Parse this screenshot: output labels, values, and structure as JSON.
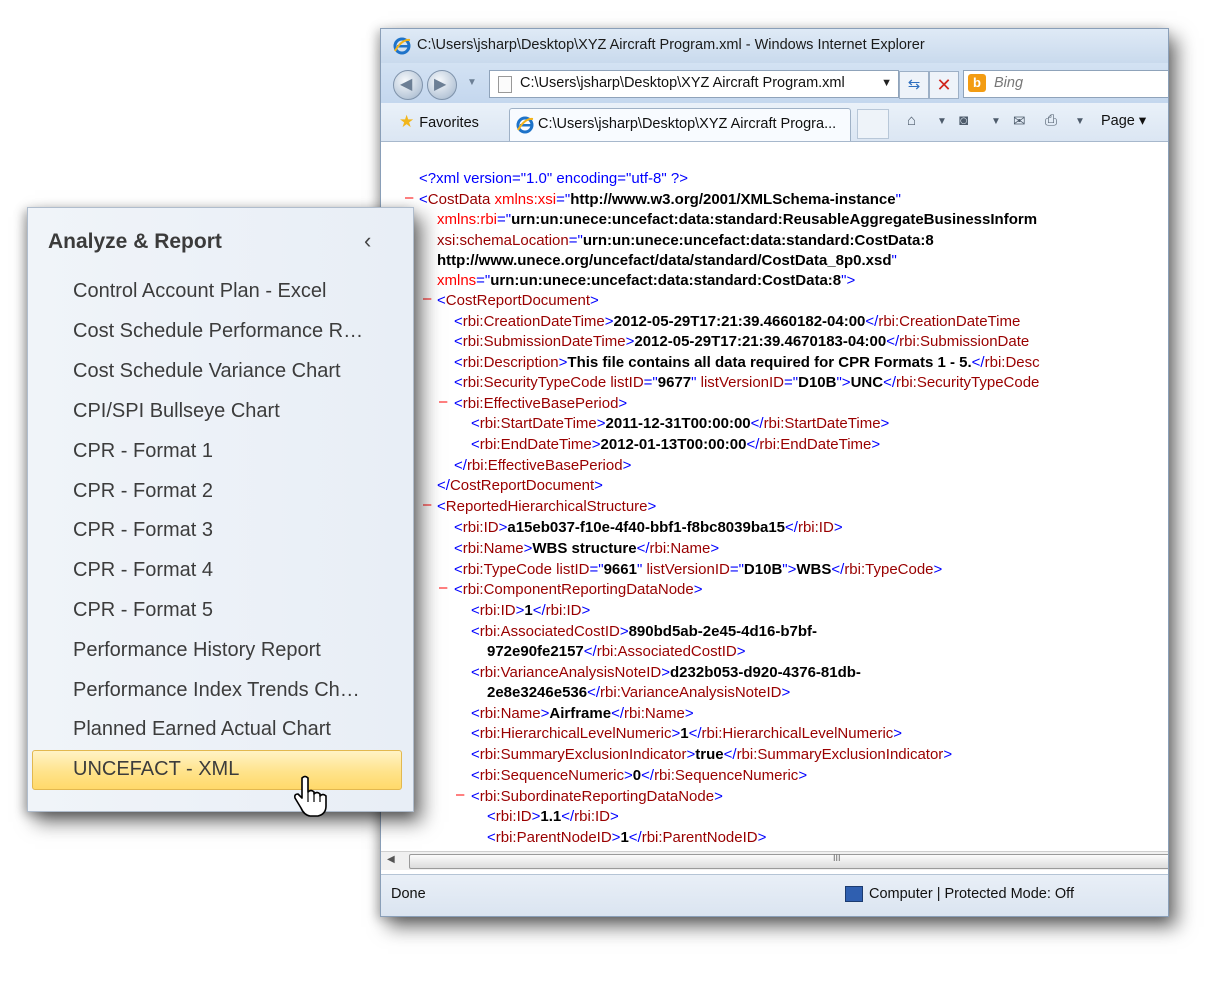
{
  "browser": {
    "title": "C:\\Users\\jsharp\\Desktop\\XYZ Aircraft Program.xml - Windows Internet Explorer",
    "address": "C:\\Users\\jsharp\\Desktop\\XYZ Aircraft Program.xml",
    "search_placeholder": "Bing",
    "favorites_label": "Favorites",
    "tab_label": "C:\\Users\\jsharp\\Desktop\\XYZ Aircraft Progra...",
    "page_label": "Page ▾",
    "status_left": "Done",
    "status_zone": "Computer | Protected Mode: Off",
    "scroll_grip": "III"
  },
  "xml": {
    "l1a": "<?xml version=\"1.0\" encoding=\"utf-8\" ?>",
    "l2a": "<",
    "l2b": "CostData",
    "l2c": " xmlns:xsi",
    "l2d": "=\"",
    "l2e": "http://www.w3.org/2001/XMLSchema-instance",
    "l2f": "\"",
    "l3a": "xmlns:rbi",
    "l3b": "=\"",
    "l3c": "urn:un:unece:uncefact:data:standard:ReusableAggregateBusinessInform",
    "l4a": "xsi:schemaLocation",
    "l4b": "=\"",
    "l4c": "urn:un:unece:uncefact:data:standard:CostData:8",
    "l5a": "http://www.unece.org/uncefact/data/standard/CostData_8p0.xsd",
    "l5b": "\"",
    "l6a": "xmlns",
    "l6b": "=\"",
    "l6c": "urn:un:unece:uncefact:data:standard:CostData:8",
    "l6d": "\">",
    "l7a": "<",
    "l7b": "CostReportDocument",
    "l7c": ">",
    "l8a": "<",
    "l8b": "rbi:CreationDateTime",
    "l8c": ">",
    "l8d": "2012-05-29T17:21:39.4660182-04:00",
    "l8e": "</",
    "l8f": "rbi:CreationDateTime",
    "l9a": "<",
    "l9b": "rbi:SubmissionDateTime",
    "l9c": ">",
    "l9d": "2012-05-29T17:21:39.4670183-04:00",
    "l9e": "</",
    "l9f": "rbi:SubmissionDate",
    "l10a": "<",
    "l10b": "rbi:Description",
    "l10c": ">",
    "l10d": "This file contains all data required for CPR Formats 1 - 5.",
    "l10e": "</",
    "l10f": "rbi:Desc",
    "l11a": "<",
    "l11b": "rbi:SecurityTypeCode",
    "l11c": " listID",
    "l11d": "=\"",
    "l11e": "9677",
    "l11f": "\"",
    "l11g": " listVersionID",
    "l11h": "=\"",
    "l11i": "D10B",
    "l11j": "\">",
    "l11k": "UNC",
    "l11l": "</",
    "l11m": "rbi:SecurityTypeCode",
    "l12a": "<",
    "l12b": "rbi:EffectiveBasePeriod",
    "l12c": ">",
    "l13a": "<",
    "l13b": "rbi:StartDateTime",
    "l13c": ">",
    "l13d": "2011-12-31T00:00:00",
    "l13e": "</",
    "l13f": "rbi:StartDateTime",
    "l13g": ">",
    "l14a": "<",
    "l14b": "rbi:EndDateTime",
    "l14c": ">",
    "l14d": "2012-01-13T00:00:00",
    "l14e": "</",
    "l14f": "rbi:EndDateTime",
    "l14g": ">",
    "l15a": "</",
    "l15b": "rbi:EffectiveBasePeriod",
    "l15c": ">",
    "l16a": "</",
    "l16b": "CostReportDocument",
    "l16c": ">",
    "l17a": "<",
    "l17b": "ReportedHierarchicalStructure",
    "l17c": ">",
    "l18a": "<",
    "l18b": "rbi:ID",
    "l18c": ">",
    "l18d": "a15eb037-f10e-4f40-bbf1-f8bc8039ba15",
    "l18e": "</",
    "l18f": "rbi:ID",
    "l18g": ">",
    "l19a": "<",
    "l19b": "rbi:Name",
    "l19c": ">",
    "l19d": "WBS structure",
    "l19e": "</",
    "l19f": "rbi:Name",
    "l19g": ">",
    "l20a": "<",
    "l20b": "rbi:TypeCode",
    "l20c": " listID",
    "l20d": "=\"",
    "l20e": "9661",
    "l20f": "\"",
    "l20g": " listVersionID",
    "l20h": "=\"",
    "l20i": "D10B",
    "l20j": "\">",
    "l20k": "WBS",
    "l20l": "</",
    "l20m": "rbi:TypeCode",
    "l20n": ">",
    "l21a": "<",
    "l21b": "rbi:ComponentReportingDataNode",
    "l21c": ">",
    "l22a": "<",
    "l22b": "rbi:ID",
    "l22c": ">",
    "l22d": "1",
    "l22e": "</",
    "l22f": "rbi:ID",
    "l22g": ">",
    "l23a": "<",
    "l23b": "rbi:AssociatedCostID",
    "l23c": ">",
    "l23d": "890bd5ab-2e45-4d16-b7bf-",
    "l24a": "972e90fe2157",
    "l24b": "</",
    "l24c": "rbi:AssociatedCostID",
    "l24d": ">",
    "l25a": "<",
    "l25b": "rbi:VarianceAnalysisNoteID",
    "l25c": ">",
    "l25d": "d232b053-d920-4376-81db-",
    "l26a": "2e8e3246e536",
    "l26b": "</",
    "l26c": "rbi:VarianceAnalysisNoteID",
    "l26d": ">",
    "l27a": "<",
    "l27b": "rbi:Name",
    "l27c": ">",
    "l27d": "Airframe",
    "l27e": "</",
    "l27f": "rbi:Name",
    "l27g": ">",
    "l28a": "<",
    "l28b": "rbi:HierarchicalLevelNumeric",
    "l28c": ">",
    "l28d": "1",
    "l28e": "</",
    "l28f": "rbi:HierarchicalLevelNumeric",
    "l28g": ">",
    "l29a": "<",
    "l29b": "rbi:SummaryExclusionIndicator",
    "l29c": ">",
    "l29d": "true",
    "l29e": "</",
    "l29f": "rbi:SummaryExclusionIndicator",
    "l29g": ">",
    "l30a": "<",
    "l30b": "rbi:SequenceNumeric",
    "l30c": ">",
    "l30d": "0",
    "l30e": "</",
    "l30f": "rbi:SequenceNumeric",
    "l30g": ">",
    "l31a": "<",
    "l31b": "rbi:SubordinateReportingDataNode",
    "l31c": ">",
    "l32a": "<",
    "l32b": "rbi:ID",
    "l32c": ">",
    "l32d": "1.1",
    "l32e": "</",
    "l32f": "rbi:ID",
    "l32g": ">",
    "l33a": "<",
    "l33b": "rbi:ParentNodeID",
    "l33c": ">",
    "l33d": "1",
    "l33e": "</",
    "l33f": "rbi:ParentNodeID",
    "l33g": ">",
    "minus": "–"
  },
  "panel": {
    "title": "Analyze & Report",
    "collapse_glyph": "‹",
    "items": [
      "Control Account Plan - Excel",
      "Cost Schedule Performance R…",
      "Cost Schedule Variance Chart",
      "CPI/SPI Bullseye Chart",
      "CPR - Format 1",
      "CPR - Format 2",
      "CPR - Format 3",
      "CPR - Format 4",
      "CPR - Format 5",
      "Performance History Report",
      "Performance Index Trends Ch…",
      "Planned Earned Actual Chart",
      "UNCEFACT - XML"
    ],
    "selected_index": 12
  }
}
